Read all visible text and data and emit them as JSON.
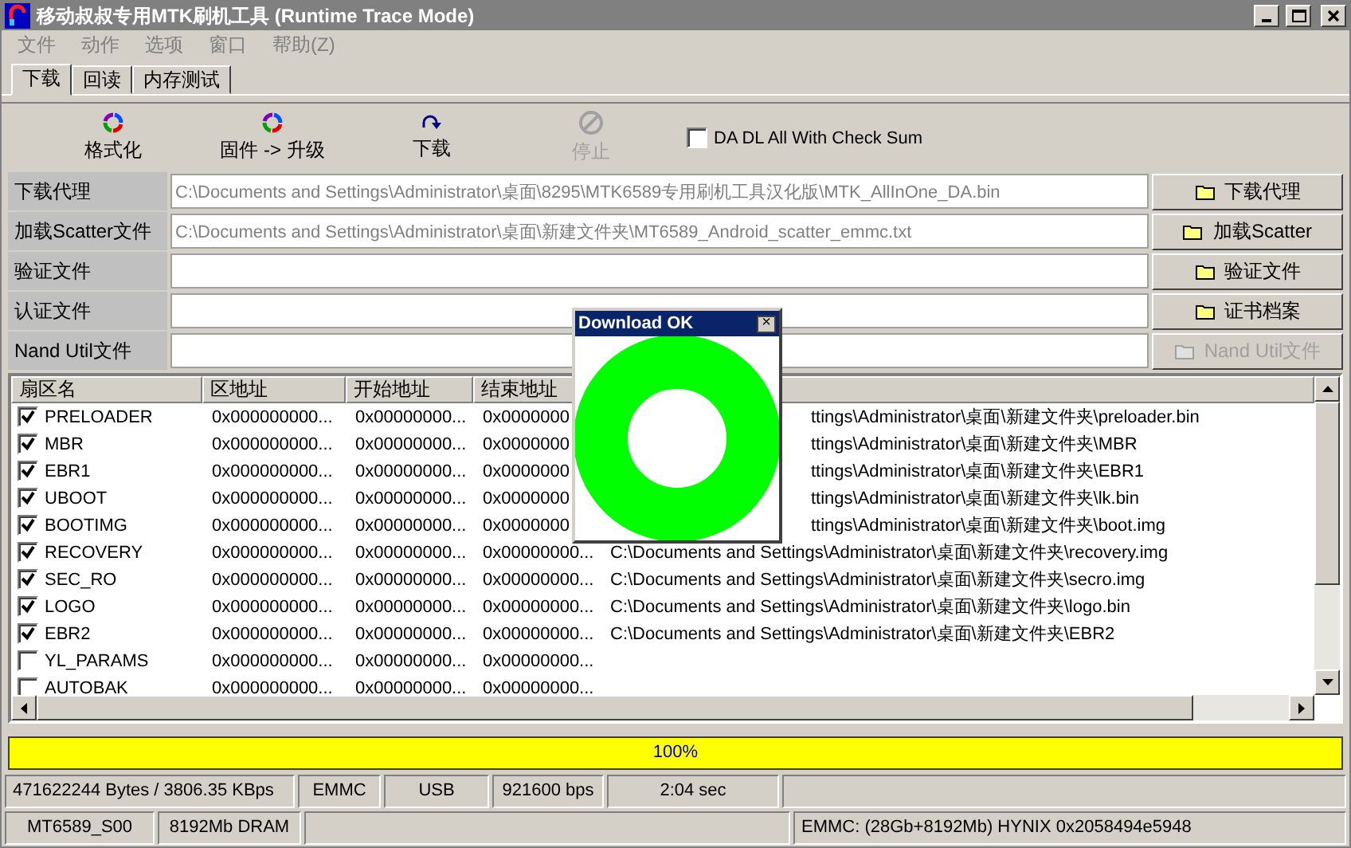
{
  "window": {
    "title": "移动叔叔专用MTK刷机工具 (Runtime Trace Mode)"
  },
  "menu": [
    "文件",
    "动作",
    "选项",
    "窗口",
    "帮助(Z)"
  ],
  "tabs": [
    {
      "label": "下载",
      "selected": true
    },
    {
      "label": "回读",
      "selected": false
    },
    {
      "label": "内存测试",
      "selected": false
    }
  ],
  "toolbar": [
    {
      "label": "格式化",
      "kind": "format",
      "disabled": false
    },
    {
      "label": "固件 -> 升级",
      "kind": "upgrade",
      "disabled": false
    },
    {
      "label": "下载",
      "kind": "download",
      "disabled": false
    },
    {
      "label": "停止",
      "kind": "stop",
      "disabled": true
    }
  ],
  "check_sum": {
    "label": "DA DL All With Check Sum",
    "checked": false
  },
  "files": [
    {
      "label": "下载代理",
      "value": "C:\\Documents and Settings\\Administrator\\桌面\\8295\\MTK6589专用刷机工具汉化版\\MTK_AllInOne_DA.bin",
      "button": "下载代理",
      "disabled": false
    },
    {
      "label": "加载Scatter文件",
      "value": "C:\\Documents and Settings\\Administrator\\桌面\\新建文件夹\\MT6589_Android_scatter_emmc.txt",
      "button": "加载Scatter",
      "disabled": false
    },
    {
      "label": "验证文件",
      "button": "验证文件",
      "disabled": false
    },
    {
      "label": "认证文件",
      "button": "证书档案",
      "disabled": false
    },
    {
      "label": "Nand Util文件",
      "button": "Nand Util文件",
      "disabled": true
    }
  ],
  "table": {
    "columns": [
      "扇区名",
      "区地址",
      "开始地址",
      "结束地址"
    ],
    "rows": [
      {
        "name": "PRELOADER",
        "checked": true,
        "region": "0x000000000...",
        "start": "0x00000000...",
        "end": "0x0000000",
        "path": "ttings\\Administrator\\桌面\\新建文件夹\\preloader.bin",
        "under_dialog": true
      },
      {
        "name": "MBR",
        "checked": true,
        "region": "0x000000000...",
        "start": "0x00000000...",
        "end": "0x0000000",
        "path": "ttings\\Administrator\\桌面\\新建文件夹\\MBR",
        "under_dialog": true
      },
      {
        "name": "EBR1",
        "checked": true,
        "region": "0x000000000...",
        "start": "0x00000000...",
        "end": "0x0000000",
        "path": "ttings\\Administrator\\桌面\\新建文件夹\\EBR1",
        "under_dialog": true
      },
      {
        "name": "UBOOT",
        "checked": true,
        "region": "0x000000000...",
        "start": "0x00000000...",
        "end": "0x0000000",
        "path": "ttings\\Administrator\\桌面\\新建文件夹\\lk.bin",
        "under_dialog": true
      },
      {
        "name": "BOOTIMG",
        "checked": true,
        "region": "0x000000000...",
        "start": "0x00000000...",
        "end": "0x0000000",
        "path": "ttings\\Administrator\\桌面\\新建文件夹\\boot.img",
        "under_dialog": true
      },
      {
        "name": "RECOVERY",
        "checked": true,
        "region": "0x000000000...",
        "start": "0x00000000...",
        "end": "0x00000000...",
        "path": "C:\\Documents and Settings\\Administrator\\桌面\\新建文件夹\\recovery.img",
        "under_dialog": false
      },
      {
        "name": "SEC_RO",
        "checked": true,
        "region": "0x000000000...",
        "start": "0x00000000...",
        "end": "0x00000000...",
        "path": "C:\\Documents and Settings\\Administrator\\桌面\\新建文件夹\\secro.img",
        "under_dialog": false
      },
      {
        "name": "LOGO",
        "checked": true,
        "region": "0x000000000...",
        "start": "0x00000000...",
        "end": "0x00000000...",
        "path": "C:\\Documents and Settings\\Administrator\\桌面\\新建文件夹\\logo.bin",
        "under_dialog": false
      },
      {
        "name": "EBR2",
        "checked": true,
        "region": "0x000000000...",
        "start": "0x00000000...",
        "end": "0x00000000...",
        "path": "C:\\Documents and Settings\\Administrator\\桌面\\新建文件夹\\EBR2",
        "under_dialog": false
      },
      {
        "name": "YL_PARAMS",
        "checked": false,
        "region": "0x000000000...",
        "start": "0x00000000...",
        "end": "0x00000000..."
      },
      {
        "name": "AUTOBAK",
        "checked": false,
        "region": "0x000000000...",
        "start": "0x00000000...",
        "end": "0x00000000..."
      }
    ]
  },
  "dialog": {
    "title": "Download OK",
    "close": "×"
  },
  "progress": {
    "level": 1,
    "reading": "100%"
  },
  "status_bar": [
    [
      {
        "kind": "text",
        "text": "471622244 Bytes / 3806.35 KBps"
      },
      {
        "kind": "text",
        "text": "EMMC"
      },
      {
        "kind": "text",
        "text": "USB"
      },
      {
        "kind": "text",
        "text": "921600 bps"
      },
      {
        "kind": "text",
        "text": "2:04 sec"
      },
      {
        "kind": "blank"
      }
    ],
    [
      {
        "kind": "text",
        "text": "MT6589_S00"
      },
      {
        "kind": "text",
        "text": "8192Mb DRAM"
      },
      {
        "kind": "blank"
      },
      {
        "kind": "text",
        "text": "EMMC: (28Gb+8192Mb) HYNIX 0x2058494e5948"
      }
    ]
  ]
}
